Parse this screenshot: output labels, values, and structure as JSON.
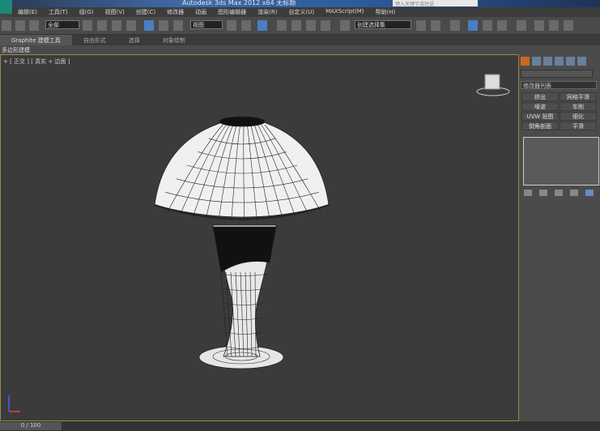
{
  "window": {
    "title": "Autodesk 3ds Max  2012 x64    无标题",
    "search_placeholder": "键入关键字或短语"
  },
  "menu": [
    "编辑(E)",
    "工具(T)",
    "组(G)",
    "视图(V)",
    "创建(C)",
    "修改器",
    "动画",
    "图形编辑器",
    "渲染(R)",
    "自定义(U)",
    "MAXScript(M)",
    "帮助(H)"
  ],
  "toolbar": {
    "selection_filter": "全部",
    "coord_system": "视图",
    "named_selection": "创建选择集"
  },
  "ribbon": {
    "tabs": [
      "Graphite 建模工具",
      "自由形式",
      "选择",
      "对象绘制"
    ],
    "sub_label": "多边形建模"
  },
  "viewport": {
    "label": "+ [ 正交 ] [ 真实 + 边面 ]"
  },
  "panel": {
    "modifier_list": "修改器列表",
    "buttons": [
      "挤出",
      "网格平滑",
      "噪波",
      "车削",
      "UVW 贴图",
      "细化",
      "倒角剖面",
      "平滑"
    ]
  },
  "status": {
    "frame": "0 / 100"
  }
}
